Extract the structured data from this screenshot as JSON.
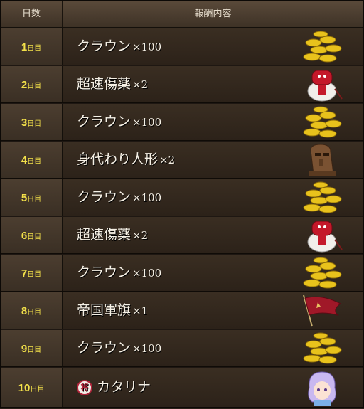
{
  "header": {
    "day_col": "日数",
    "reward_col": "報酬内容"
  },
  "rows": [
    {
      "day": "1",
      "unit": "日目",
      "item": "クラウン",
      "qty": "×100",
      "icon": "gold-coins-icon"
    },
    {
      "day": "2",
      "unit": "日目",
      "item": "超速傷薬",
      "qty": "×2",
      "icon": "potion-jar-icon"
    },
    {
      "day": "3",
      "unit": "日目",
      "item": "クラウン",
      "qty": "×100",
      "icon": "gold-coins-icon"
    },
    {
      "day": "4",
      "unit": "日目",
      "item": "身代わり人形",
      "qty": "×2",
      "icon": "stone-doll-icon"
    },
    {
      "day": "5",
      "unit": "日目",
      "item": "クラウン",
      "qty": "×100",
      "icon": "gold-coins-icon"
    },
    {
      "day": "6",
      "unit": "日目",
      "item": "超速傷薬",
      "qty": "×2",
      "icon": "potion-jar-icon"
    },
    {
      "day": "7",
      "unit": "日目",
      "item": "クラウン",
      "qty": "×100",
      "icon": "gold-coins-icon"
    },
    {
      "day": "8",
      "unit": "日目",
      "item": "帝国軍旗",
      "qty": "×1",
      "icon": "imperial-banner-icon"
    },
    {
      "day": "9",
      "unit": "日目",
      "item": "クラウン",
      "qty": "×100",
      "icon": "gold-coins-icon"
    },
    {
      "day": "10",
      "unit": "日目",
      "item": "カタリナ",
      "qty": "",
      "badge": "将",
      "icon": "character-portrait-icon"
    }
  ]
}
